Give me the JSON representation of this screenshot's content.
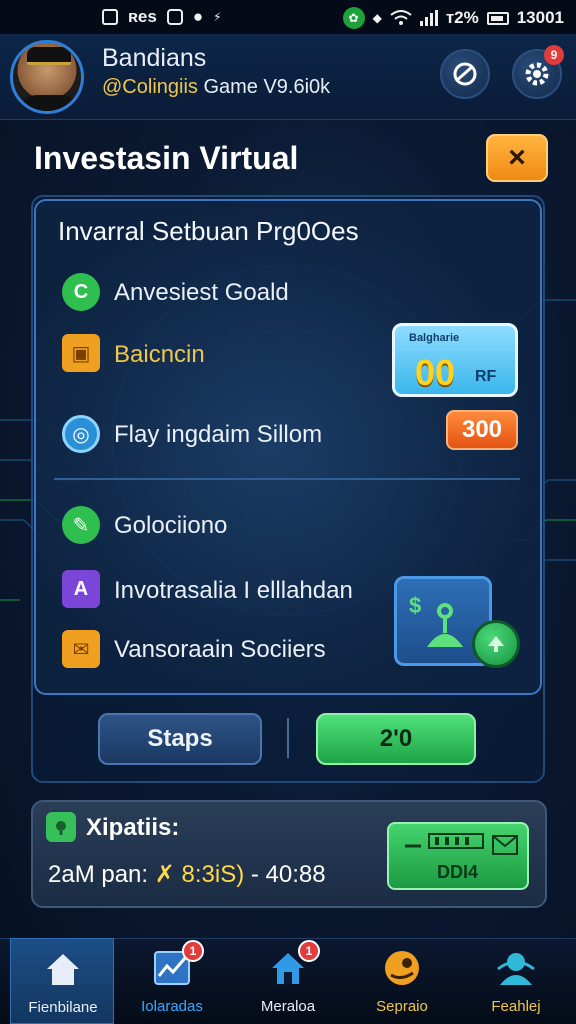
{
  "status_bar": {
    "left_text": "ʀes",
    "right_text": "ᴛ2%",
    "time": "13001",
    "icons": [
      "notification-box-icon",
      "image-icon",
      "message-icon",
      "bolt-icon",
      "wifi-icon",
      "signal-icon",
      "battery-icon"
    ]
  },
  "header": {
    "user_name": "Bandians",
    "handle_prefix": "@Colingiis",
    "handle_rest": " Game V9.6i0k",
    "settings_badge": "9",
    "buttons": [
      "sync-icon",
      "gear-icon"
    ]
  },
  "dialog": {
    "title": "Investasin Virtual",
    "close_label": "×"
  },
  "panel": {
    "section_title": "Invarral Setbuan Prg0Oes",
    "rows": [
      {
        "label": "Anvesiest Goald",
        "icon": "c-coin-icon",
        "color": "#2fbf4f"
      },
      {
        "label": "Baicncin",
        "icon": "box-icon",
        "color": "#f0a020"
      },
      {
        "label": "Flay ingdaim Sillom",
        "icon": "target-icon",
        "color": "#2a8fd8"
      },
      {
        "label": "Golociiono",
        "icon": "leaf-icon",
        "color": "#2fbf4f"
      },
      {
        "label": "Invotrasalia I elllahdan",
        "icon": "a-letter-icon",
        "color": "#7b45d8"
      },
      {
        "label": "Vansoraain Sociiers",
        "icon": "mail-icon",
        "color": "#f0a020"
      }
    ],
    "value_box": {
      "caption": "Balgharie",
      "value": "00",
      "unit": "RF"
    },
    "orange_value": "300",
    "tile_label": "$",
    "tile_icon": "gift-icon"
  },
  "actions": {
    "secondary_label": "Staps",
    "primary_label": "2'0"
  },
  "info": {
    "title": "Xipatiis:",
    "detail_prefix": "2aM pan: ",
    "detail_amount": "✗ 8:3iS)",
    "detail_suffix": " - 40:88",
    "card_label": "DDI4"
  },
  "nav": {
    "items": [
      {
        "label": "Fienbilane",
        "icon": "home-icon",
        "color": "#e8eef7",
        "badge": ""
      },
      {
        "label": "Iolaradas",
        "icon": "chart-icon",
        "color": "#3aa8ff",
        "badge": "1"
      },
      {
        "label": "Meraloa",
        "icon": "house-icon",
        "color": "#e8eef7",
        "badge": "1"
      },
      {
        "label": "Sepraio",
        "icon": "coin-face-icon",
        "color": "#f0c64a",
        "badge": ""
      },
      {
        "label": "Feahlej",
        "icon": "profile-icon",
        "color": "#f0c64a",
        "badge": ""
      }
    ]
  },
  "colors": {
    "accent_blue": "#3a78c2",
    "accent_green": "#1fa446",
    "accent_orange": "#f08a14",
    "badge_red": "#e23b3b"
  }
}
